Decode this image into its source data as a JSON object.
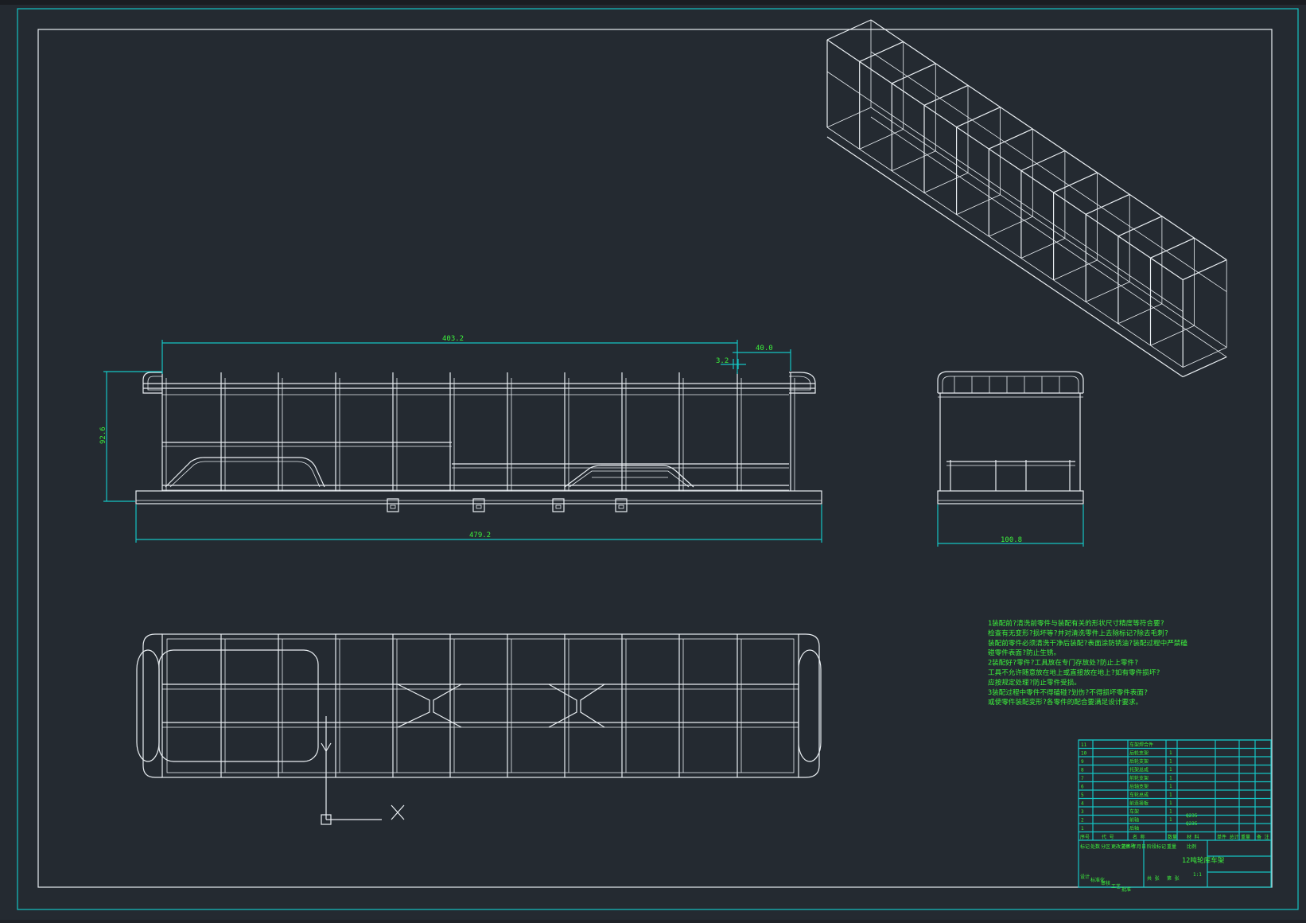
{
  "drawing": {
    "dimensions": {
      "top_length": "403.2",
      "end_offset": "40.0",
      "small_gap": "3.2",
      "height": "92.6",
      "base_length": "479.2",
      "side_width": "100.8"
    },
    "tech_requirements": [
      "1装配前?清洗前零件与装配有关的形状尺寸精度等符合要?",
      "检查有无变形?损坏等?并对清洗零件上去除标记?除去毛刺?",
      "装配前零件必须清洗干净后装配?表面涂防锈油?装配过程中严禁磕",
      "碰零件表面?防止生锈。",
      "2装配好?零件?工具放在专门存放处?防止上零件?",
      "工具不允许随意放在地上或直接放在地上?如有零件损坏?",
      "应按规定处理?防止零件受损。",
      "3装配过程中零件不得磕碰?划伤?不得损坏零件表面?",
      "或使零件装配变形?各零件的配合要满足设计要求。"
    ],
    "title_block": {
      "drawing_title": "12吨轮库车架",
      "material_1": "Q235",
      "material_2": "Q235",
      "parts": [
        "车架焊合件",
        "后轮支架",
        "后轮支架",
        "托架总成",
        "前轮支架",
        "后轴支架",
        "车轮总成",
        "前连接板",
        "车架",
        "前轴",
        "后轴"
      ],
      "qty": [
        "1",
        "1",
        "1",
        "1",
        "1",
        "1",
        "1",
        "1",
        "1"
      ],
      "headers": [
        "序号",
        "代 号",
        "名 称",
        "数量",
        "材 料",
        "单件 总计",
        "重量",
        "备 注"
      ],
      "sign_labels": [
        "标记",
        "处数",
        "分区",
        "更改文件号",
        "签名",
        "年月日",
        "设计",
        "标准化",
        "审核",
        "工艺",
        "批准"
      ],
      "stage_labels": [
        "阶段标记",
        "重量",
        "比例",
        "共 张",
        "第 张"
      ],
      "scale": "1:1"
    },
    "ucs": {
      "x": "X",
      "y": "Y"
    }
  }
}
